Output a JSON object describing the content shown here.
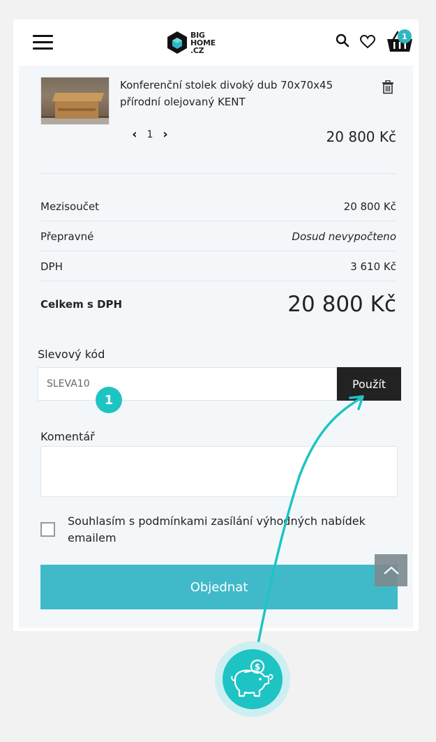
{
  "header": {
    "menu_icon": "hamburger-menu-icon",
    "logo_lines": [
      "BIG",
      "HOME",
      ".CZ"
    ],
    "search_icon": "search-icon",
    "wishlist_icon": "heart-icon",
    "cart_icon": "basket-icon",
    "cart_count": "1"
  },
  "cart": {
    "item": {
      "name": "Konferenční stolek divoký dub 70x70x45 přírodní olejovaný KENT",
      "quantity": "1",
      "price": "20 800 Kč",
      "delete_icon": "trash-icon"
    }
  },
  "summary": {
    "subtotal_label": "Mezisoučet",
    "subtotal_value": "20 800 Kč",
    "shipping_label": "Přepravné",
    "shipping_value": "Dosud nevypočteno",
    "vat_label": "DPH",
    "vat_value": "3 610 Kč",
    "total_label": "Celkem s DPH",
    "total_value": "20 800 Kč"
  },
  "coupon": {
    "label": "Slevový kód",
    "value": "SLEVA10",
    "apply_label": "Použít",
    "step_number": "1"
  },
  "comment": {
    "label": "Komentář",
    "value": ""
  },
  "consent": {
    "checked": false,
    "label": "Souhlasím s podmínkami zasílání výhodných nabídek emailem"
  },
  "order": {
    "button_label": "Objednat"
  },
  "overlay": {
    "icon": "piggy-bank-coin-icon",
    "accent_color": "#1ec4c4"
  }
}
